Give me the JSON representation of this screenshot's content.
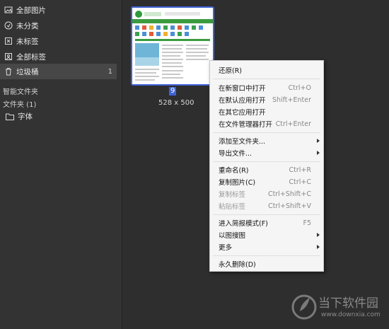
{
  "sidebar": {
    "items": [
      {
        "label": "全部图片",
        "icon": "all-images-icon"
      },
      {
        "label": "未分类",
        "icon": "uncategorized-icon"
      },
      {
        "label": "未标签",
        "icon": "untagged-icon"
      },
      {
        "label": "全部标签",
        "icon": "all-tags-icon"
      },
      {
        "label": "垃圾桶",
        "icon": "trash-icon",
        "count": "1"
      }
    ],
    "smart_folders_label": "智能文件夹",
    "folders_label": "文件夹 (1)",
    "folders": [
      {
        "label": "字体",
        "icon": "folder-icon"
      }
    ]
  },
  "thumbnail": {
    "caption": "9",
    "size": "528 x 500"
  },
  "context_menu": {
    "restore": "还原(R)",
    "open_new_window": "在新窗口中打开",
    "open_new_window_sc": "Ctrl+O",
    "open_default_app": "在默认应用打开",
    "open_default_app_sc": "Shift+Enter",
    "open_other_app": "在其它应用打开",
    "open_file_manager": "在文件管理器打开",
    "open_file_manager_sc": "Ctrl+Enter",
    "add_to_folder": "添加至文件夹...",
    "export_file": "导出文件...",
    "rename": "重命名(R)",
    "rename_sc": "Ctrl+R",
    "copy_image": "复制图片(C)",
    "copy_image_sc": "Ctrl+C",
    "copy_tags": "复制标签",
    "copy_tags_sc": "Ctrl+Shift+C",
    "paste_tags": "粘贴标签",
    "paste_tags_sc": "Ctrl+Shift+V",
    "simple_mode": "进入简报模式(F)",
    "simple_mode_sc": "F5",
    "search_by_image": "以图搜图",
    "more": "更多",
    "delete_permanently": "永久删除(D)"
  },
  "watermark": {
    "text": "当下软件园",
    "url": "www.downxia.com"
  },
  "colors": {
    "accent": "#3f63d6",
    "sidebar_bg": "#333333",
    "main_bg": "#2e2e2e",
    "menu_bg": "#f5f5f5"
  }
}
